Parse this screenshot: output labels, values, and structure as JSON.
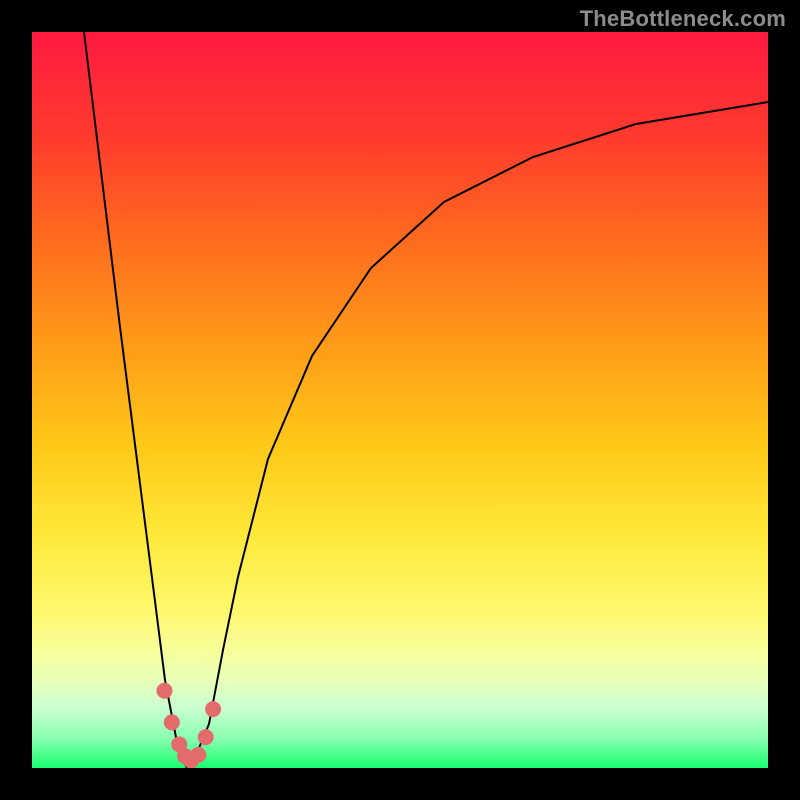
{
  "watermark": {
    "text": "TheBottleneck.com"
  },
  "chart_data": {
    "type": "line",
    "title": "",
    "xlabel": "",
    "ylabel": "",
    "xlim": [
      0,
      100
    ],
    "ylim": [
      0,
      100
    ],
    "grid": false,
    "legend": "none",
    "series": [
      {
        "name": "bottleneck-curve",
        "x": [
          7,
          12,
          16,
          18,
          20,
          21,
          22,
          24,
          26,
          28,
          32,
          38,
          46,
          56,
          68,
          82,
          100
        ],
        "y": [
          100,
          60,
          28,
          12,
          2,
          0,
          1,
          6,
          16,
          26,
          42,
          56,
          68,
          77,
          83,
          87,
          90
        ]
      }
    ],
    "markers": {
      "name": "valley-dots",
      "color": "#e36b6b",
      "x": [
        18.0,
        19.0,
        20.0,
        20.8,
        21.6,
        22.6,
        23.6,
        24.6
      ],
      "y": [
        10.5,
        6.2,
        3.2,
        1.6,
        1.0,
        1.8,
        4.2,
        8.0
      ]
    },
    "gradient": {
      "top": "#ff1a40",
      "bottom": "#18ff70",
      "note": "red at top (worst) to green at bottom (best)"
    }
  }
}
